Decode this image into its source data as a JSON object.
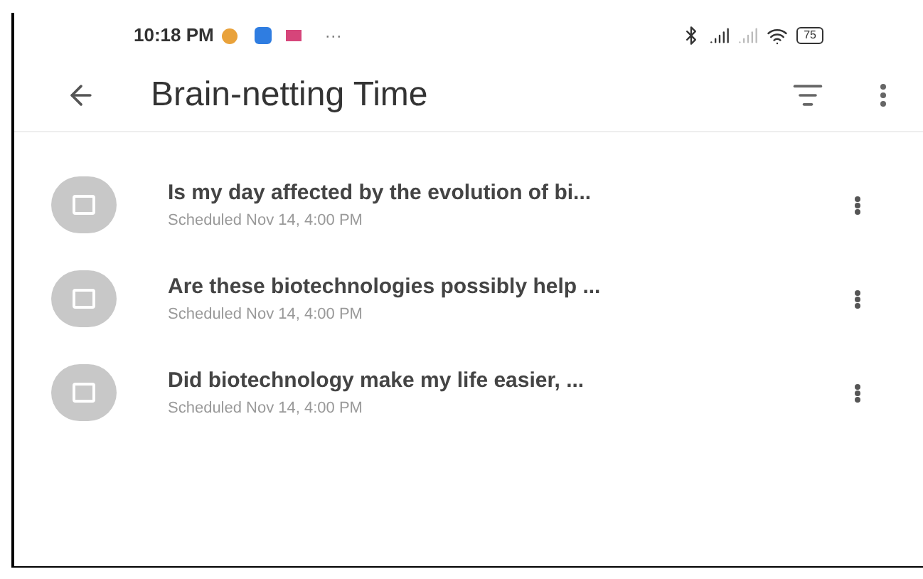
{
  "status_bar": {
    "time": "10:18 PM",
    "more": "···",
    "battery": "75"
  },
  "app_bar": {
    "title": "Brain-netting Time"
  },
  "items": [
    {
      "title": "Is my day affected by the evolution of bi...",
      "subtitle": "Scheduled Nov 14, 4:00 PM"
    },
    {
      "title": "Are these biotechnologies possibly help ...",
      "subtitle": "Scheduled Nov 14, 4:00 PM"
    },
    {
      "title": "Did biotechnology make my life easier, ...",
      "subtitle": "Scheduled Nov 14, 4:00 PM"
    }
  ]
}
